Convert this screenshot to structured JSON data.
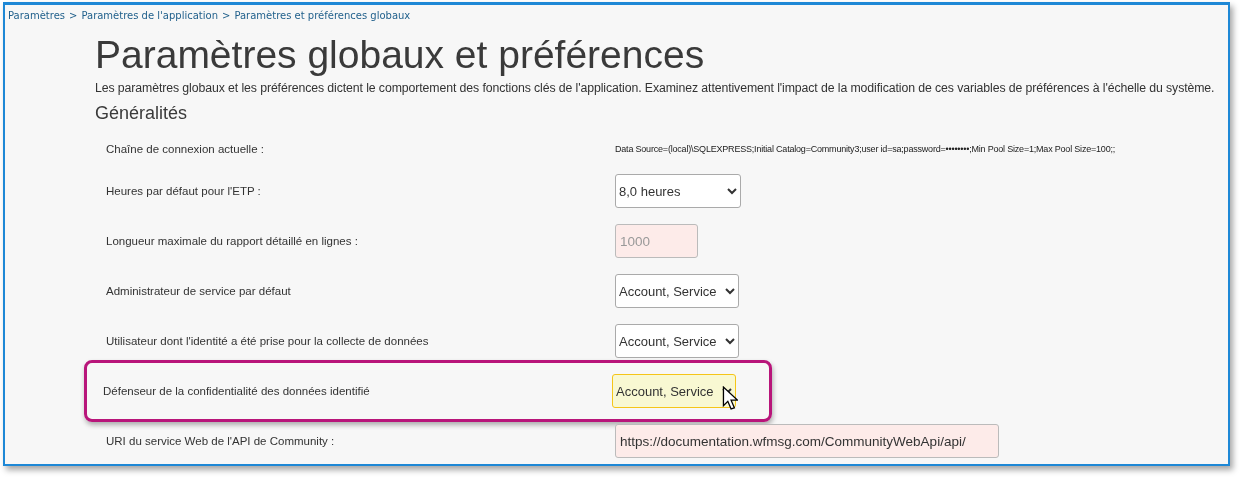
{
  "breadcrumb": [
    "Paramètres",
    "Paramètres de l'application",
    "Paramètres et préférences globaux"
  ],
  "breadcrumb_separator": ">",
  "title": "Paramètres globaux et préférences",
  "description": "Les paramètres globaux et les préférences dictent le comportement des fonctions clés de l'application. Examinez attentivement l'impact de la modification de ces variables de préférences à l'échelle du système.",
  "section": "Généralités",
  "settings": [
    {
      "label": "Chaîne de connexion actuelle :",
      "kind": "text",
      "value": "Data Source=(local)\\SQLEXPRESS;Initial Catalog=Community3;user id=sa;password=••••••••;Min Pool Size=1;Max Pool Size=100;;",
      "highlighted": false
    },
    {
      "label": "Heures par défaut pour l'ETP :",
      "kind": "select",
      "value": "8,0 heures",
      "highlighted": false
    },
    {
      "label": "Longueur maximale du rapport détaillé en lignes :",
      "kind": "input",
      "value": "1000",
      "disabled": true,
      "highlighted": false
    },
    {
      "label": "Administrateur de service par défaut",
      "kind": "select",
      "value": "Account, Service",
      "highlighted": false
    },
    {
      "label": "Utilisateur dont l'identité a été prise pour la collecte de données",
      "kind": "select",
      "value": "Account, Service",
      "highlighted": false
    },
    {
      "label": "Défenseur de la confidentialité des données identifié",
      "kind": "select",
      "value": "Account, Service",
      "highlighted": true
    },
    {
      "label": "URI du service Web de l'API de Community :",
      "kind": "input",
      "value": "https://documentation.wfmsg.com/CommunityWebApi/api/",
      "disabled": false,
      "highlighted": false
    }
  ]
}
